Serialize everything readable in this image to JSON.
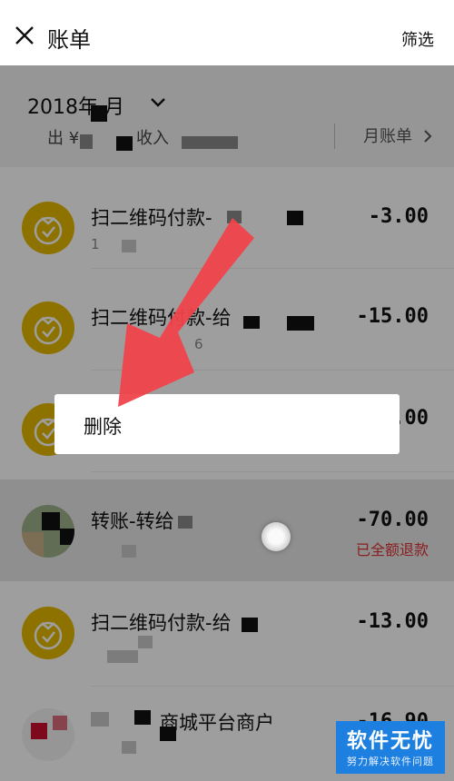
{
  "header": {
    "title": "账单",
    "filter_label": "筛选"
  },
  "summary": {
    "month": "2018年 月",
    "expense_label": "出 ¥",
    "income_label": "收入",
    "monthly_bill_label": "月账单"
  },
  "transactions": [
    {
      "title": "扫二维码付款-",
      "amount": "-3.00",
      "sub": "1",
      "icon": "coin-bag-icon"
    },
    {
      "title": "扫二维码付款-给",
      "amount": "-15.00",
      "sub": "6",
      "icon": "coin-bag-icon"
    },
    {
      "title": "",
      "amount": "-.00",
      "sub": "",
      "icon": "coin-bag-icon"
    },
    {
      "title": "转账-转给",
      "amount": "-70.00",
      "status": "已全额退款",
      "icon": "contact-avatar"
    },
    {
      "title": "扫二维码付款-给",
      "amount": "-13.00",
      "sub": "",
      "icon": "coin-bag-icon"
    },
    {
      "title": "商城平台商户",
      "amount": "-16.90",
      "sub": "",
      "icon": "merchant-avatar"
    }
  ],
  "context_menu": {
    "delete_label": "删除"
  },
  "watermark": {
    "main": "软件无忧",
    "sub": "努力解决软件问题"
  },
  "colors": {
    "coin": "#e6b800",
    "arrow": "#f0434c",
    "refund_text": "#d33333",
    "watermark_bg": "#1d7fe0"
  }
}
